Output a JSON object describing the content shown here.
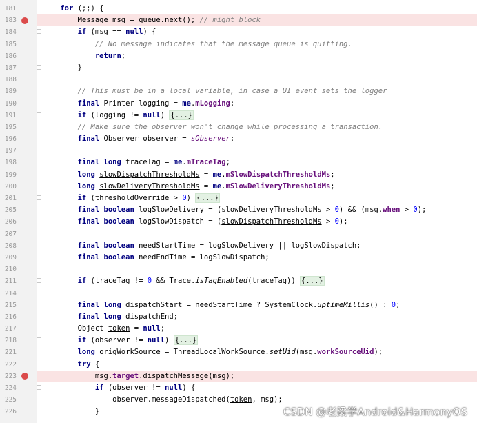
{
  "editor": {
    "lines": [
      {
        "n": "181",
        "indent": "    ",
        "code": "for (;;) {",
        "bp": false,
        "fold": true
      },
      {
        "n": "183",
        "indent": "        ",
        "code": "Message msg = queue.next(); // might block",
        "bp": true,
        "fold": false
      },
      {
        "n": "184",
        "indent": "        ",
        "code": "if (msg == null) {",
        "bp": false,
        "fold": true
      },
      {
        "n": "185",
        "indent": "            ",
        "code": "// No message indicates that the message queue is quitting.",
        "bp": false,
        "fold": false
      },
      {
        "n": "186",
        "indent": "            ",
        "code": "return;",
        "bp": false,
        "fold": false
      },
      {
        "n": "187",
        "indent": "        ",
        "code": "}",
        "bp": false,
        "fold": true
      },
      {
        "n": "188",
        "indent": "",
        "code": "",
        "bp": false,
        "fold": false
      },
      {
        "n": "189",
        "indent": "        ",
        "code": "// This must be in a local variable, in case a UI event sets the logger",
        "bp": false,
        "fold": false
      },
      {
        "n": "190",
        "indent": "        ",
        "code": "final Printer logging = me.mLogging;",
        "bp": false,
        "fold": false
      },
      {
        "n": "191",
        "indent": "        ",
        "code": "if (logging != null) {...}",
        "bp": false,
        "fold": true
      },
      {
        "n": "195",
        "indent": "        ",
        "code": "// Make sure the observer won't change while processing a transaction.",
        "bp": false,
        "fold": false
      },
      {
        "n": "196",
        "indent": "        ",
        "code": "final Observer observer = sObserver;",
        "bp": false,
        "fold": false
      },
      {
        "n": "197",
        "indent": "",
        "code": "",
        "bp": false,
        "fold": false
      },
      {
        "n": "198",
        "indent": "        ",
        "code": "final long traceTag = me.mTraceTag;",
        "bp": false,
        "fold": false
      },
      {
        "n": "199",
        "indent": "        ",
        "code": "long slowDispatchThresholdMs = me.mSlowDispatchThresholdMs;",
        "bp": false,
        "fold": false
      },
      {
        "n": "200",
        "indent": "        ",
        "code": "long slowDeliveryThresholdMs = me.mSlowDeliveryThresholdMs;",
        "bp": false,
        "fold": false
      },
      {
        "n": "201",
        "indent": "        ",
        "code": "if (thresholdOverride > 0) {...}",
        "bp": false,
        "fold": true
      },
      {
        "n": "205",
        "indent": "        ",
        "code": "final boolean logSlowDelivery = (slowDeliveryThresholdMs > 0) && (msg.when > 0);",
        "bp": false,
        "fold": false
      },
      {
        "n": "206",
        "indent": "        ",
        "code": "final boolean logSlowDispatch = (slowDispatchThresholdMs > 0);",
        "bp": false,
        "fold": false
      },
      {
        "n": "207",
        "indent": "",
        "code": "",
        "bp": false,
        "fold": false
      },
      {
        "n": "208",
        "indent": "        ",
        "code": "final boolean needStartTime = logSlowDelivery || logSlowDispatch;",
        "bp": false,
        "fold": false
      },
      {
        "n": "209",
        "indent": "        ",
        "code": "final boolean needEndTime = logSlowDispatch;",
        "bp": false,
        "fold": false
      },
      {
        "n": "210",
        "indent": "",
        "code": "",
        "bp": false,
        "fold": false
      },
      {
        "n": "211",
        "indent": "        ",
        "code": "if (traceTag != 0 && Trace.isTagEnabled(traceTag)) {...}",
        "bp": false,
        "fold": true
      },
      {
        "n": "214",
        "indent": "",
        "code": "",
        "bp": false,
        "fold": false
      },
      {
        "n": "215",
        "indent": "        ",
        "code": "final long dispatchStart = needStartTime ? SystemClock.uptimeMillis() : 0;",
        "bp": false,
        "fold": false
      },
      {
        "n": "216",
        "indent": "        ",
        "code": "final long dispatchEnd;",
        "bp": false,
        "fold": false
      },
      {
        "n": "217",
        "indent": "        ",
        "code": "Object token = null;",
        "bp": false,
        "fold": false
      },
      {
        "n": "218",
        "indent": "        ",
        "code": "if (observer != null) {...}",
        "bp": false,
        "fold": true
      },
      {
        "n": "221",
        "indent": "        ",
        "code": "long origWorkSource = ThreadLocalWorkSource.setUid(msg.workSourceUid);",
        "bp": false,
        "fold": false
      },
      {
        "n": "222",
        "indent": "        ",
        "code": "try {",
        "bp": false,
        "fold": true
      },
      {
        "n": "223",
        "indent": "            ",
        "code": "msg.target.dispatchMessage(msg);",
        "bp": true,
        "fold": false
      },
      {
        "n": "224",
        "indent": "            ",
        "code": "if (observer != null) {",
        "bp": false,
        "fold": true
      },
      {
        "n": "225",
        "indent": "                ",
        "code": "observer.messageDispatched(token, msg);",
        "bp": false,
        "fold": false
      },
      {
        "n": "226",
        "indent": "            ",
        "code": "}",
        "bp": false,
        "fold": true
      }
    ]
  },
  "watermark": "CSDN @老梁学Android&HarmonyOS",
  "colors": {
    "keyword": "#000080",
    "comment": "#808080",
    "number": "#0000ff",
    "field": "#660e7a",
    "breakpoint": "#db4b4b",
    "breakpoint_line": "#fae3e3"
  }
}
